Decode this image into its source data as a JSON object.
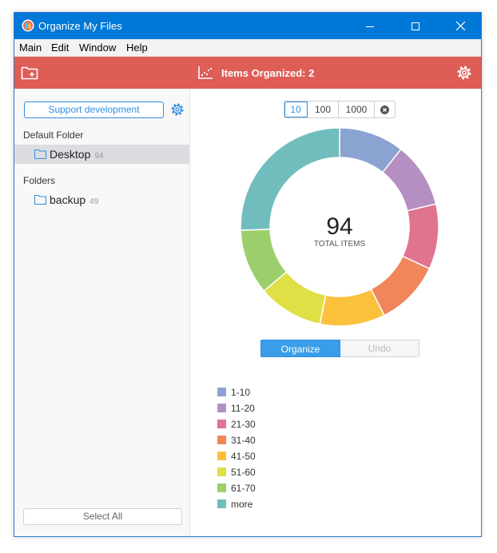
{
  "window": {
    "title": "Organize My Files"
  },
  "menu": [
    "Main",
    "Edit",
    "Window",
    "Help"
  ],
  "toolbar": {
    "status_label": "Items Organized: 2"
  },
  "sidebar": {
    "support_label": "Support development",
    "default_folder_label": "Default Folder",
    "default_folder": {
      "name": "Desktop",
      "count": "94"
    },
    "folders_label": "Folders",
    "folders": [
      {
        "name": "backup",
        "count": "49"
      }
    ],
    "select_all_label": "Select All"
  },
  "range_options": [
    "10",
    "100",
    "1000"
  ],
  "range_selected": "10",
  "chart_data": {
    "type": "pie",
    "center_value": "94",
    "center_label": "TOTAL ITEMS",
    "categories": [
      "1-10",
      "11-20",
      "21-30",
      "31-40",
      "41-50",
      "51-60",
      "61-70",
      "more"
    ],
    "values": [
      10,
      10,
      10,
      10,
      10,
      10,
      10,
      24
    ],
    "colors": [
      "#8ba3d1",
      "#b68fc2",
      "#e07490",
      "#f0865a",
      "#fbc13d",
      "#e0df45",
      "#9ccf6b",
      "#71bdbd"
    ],
    "legend_position": "bottom-left"
  },
  "actions": {
    "organize_label": "Organize",
    "undo_label": "Undo"
  }
}
